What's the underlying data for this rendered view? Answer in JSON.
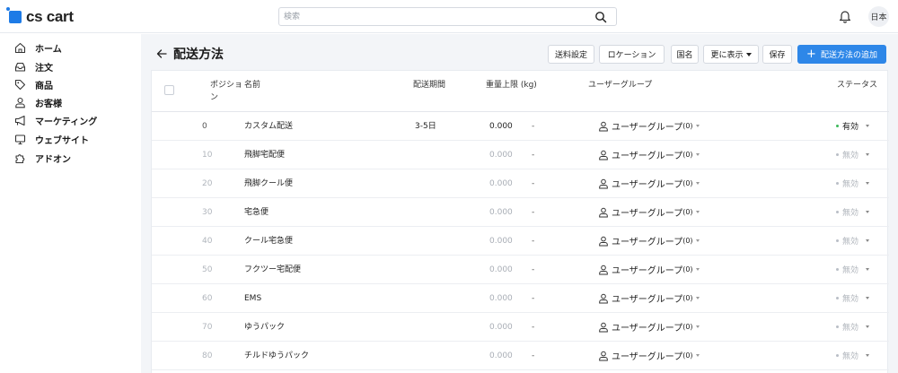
{
  "app": {
    "logo_text": "cs cart"
  },
  "search": {
    "placeholder": "検索"
  },
  "header": {
    "avatar_text": "日本"
  },
  "sidebar": {
    "items": [
      {
        "label": "ホーム",
        "icon": "home-icon"
      },
      {
        "label": "注文",
        "icon": "inbox-icon"
      },
      {
        "label": "商品",
        "icon": "tag-icon"
      },
      {
        "label": "お客様",
        "icon": "user-icon"
      },
      {
        "label": "マーケティング",
        "icon": "megaphone-icon"
      },
      {
        "label": "ウェブサイト",
        "icon": "monitor-icon"
      },
      {
        "label": "アドオン",
        "icon": "puzzle-icon"
      }
    ]
  },
  "page": {
    "title": "配送方法"
  },
  "toolbar": {
    "shipping_settings": "送料設定",
    "locations": "ロケーション",
    "countries": "国名",
    "more": "更に表示",
    "save": "保存",
    "add": "配送方法の追加"
  },
  "table": {
    "headers": {
      "position": "ポジション",
      "name": "名前",
      "delivery_time": "配送期間",
      "weight_limit": "重量上限 (kg)",
      "user_group": "ユーザーグループ",
      "status": "ステータス"
    },
    "rows": [
      {
        "position": "0",
        "name": "カスタム配送",
        "delivery": "3-5日",
        "weight_min": "0.000",
        "weight_max": "-",
        "usergroup": "ユーザーグループ",
        "usergroup_count": "(0)",
        "status": "有効",
        "active": true
      },
      {
        "position": "10",
        "name": "飛脚宅配便",
        "delivery": "",
        "weight_min": "0.000",
        "weight_max": "-",
        "usergroup": "ユーザーグループ",
        "usergroup_count": "(0)",
        "status": "無効",
        "active": false
      },
      {
        "position": "20",
        "name": "飛脚クール便",
        "delivery": "",
        "weight_min": "0.000",
        "weight_max": "-",
        "usergroup": "ユーザーグループ",
        "usergroup_count": "(0)",
        "status": "無効",
        "active": false
      },
      {
        "position": "30",
        "name": "宅急便",
        "delivery": "",
        "weight_min": "0.000",
        "weight_max": "-",
        "usergroup": "ユーザーグループ",
        "usergroup_count": "(0)",
        "status": "無効",
        "active": false
      },
      {
        "position": "40",
        "name": "クール宅急便",
        "delivery": "",
        "weight_min": "0.000",
        "weight_max": "-",
        "usergroup": "ユーザーグループ",
        "usergroup_count": "(0)",
        "status": "無効",
        "active": false
      },
      {
        "position": "50",
        "name": "フクツー宅配便",
        "delivery": "",
        "weight_min": "0.000",
        "weight_max": "-",
        "usergroup": "ユーザーグループ",
        "usergroup_count": "(0)",
        "status": "無効",
        "active": false
      },
      {
        "position": "60",
        "name": "EMS",
        "delivery": "",
        "weight_min": "0.000",
        "weight_max": "-",
        "usergroup": "ユーザーグループ",
        "usergroup_count": "(0)",
        "status": "無効",
        "active": false
      },
      {
        "position": "70",
        "name": "ゆうパック",
        "delivery": "",
        "weight_min": "0.000",
        "weight_max": "-",
        "usergroup": "ユーザーグループ",
        "usergroup_count": "(0)",
        "status": "無効",
        "active": false
      },
      {
        "position": "80",
        "name": "チルドゆうパック",
        "delivery": "",
        "weight_min": "0.000",
        "weight_max": "-",
        "usergroup": "ユーザーグループ",
        "usergroup_count": "(0)",
        "status": "無効",
        "active": false
      }
    ]
  },
  "colors": {
    "accent": "#2e87e8",
    "active_dot": "#3cb95a",
    "inactive_dot": "#b9bec6",
    "background": "#f3f5f8"
  }
}
